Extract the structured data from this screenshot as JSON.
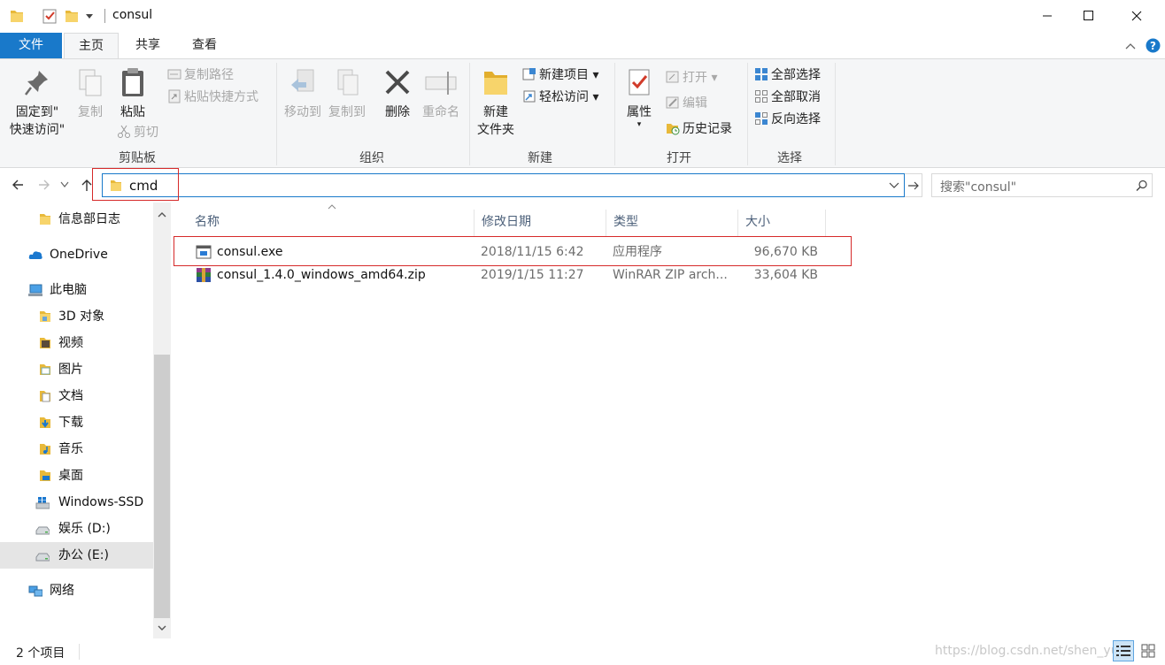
{
  "window": {
    "title": "consul",
    "controls": [
      "minimize-icon",
      "maximize-icon",
      "close-icon"
    ]
  },
  "ribbon_tabs": [
    {
      "label": "文件"
    },
    {
      "label": "主页"
    },
    {
      "label": "共享"
    },
    {
      "label": "查看"
    }
  ],
  "ribbon": {
    "clipboard": {
      "label": "剪贴板",
      "pin_line1": "固定到\"",
      "pin_line2": "快速访问\"",
      "copy": "复制",
      "paste": "粘贴",
      "copy_path": "复制路径",
      "paste_shortcut": "粘贴快捷方式",
      "cut": "剪切"
    },
    "organize": {
      "label": "组织",
      "move_to": "移动到",
      "copy_to": "复制到",
      "delete": "删除",
      "rename": "重命名"
    },
    "new": {
      "label": "新建",
      "new_folder_line1": "新建",
      "new_folder_line2": "文件夹",
      "new_item": "新建项目",
      "easy_access": "轻松访问"
    },
    "open": {
      "label": "打开",
      "properties": "属性",
      "open": "打开",
      "edit": "编辑",
      "history": "历史记录"
    },
    "select": {
      "label": "选择",
      "select_all": "全部选择",
      "select_none": "全部取消",
      "invert": "反向选择"
    }
  },
  "address": {
    "value": "cmd",
    "search_placeholder": "搜索\"consul\""
  },
  "nav": [
    {
      "label": "信息部日志",
      "icon": "folder-icon"
    },
    {
      "label": "OneDrive",
      "icon": "cloud-icon"
    },
    {
      "label": "此电脑",
      "icon": "computer-icon"
    },
    {
      "label": "3D 对象",
      "icon": "3d-objects-icon"
    },
    {
      "label": "视频",
      "icon": "video-icon"
    },
    {
      "label": "图片",
      "icon": "pictures-icon"
    },
    {
      "label": "文档",
      "icon": "documents-icon"
    },
    {
      "label": "下载",
      "icon": "downloads-icon"
    },
    {
      "label": "音乐",
      "icon": "music-icon"
    },
    {
      "label": "桌面",
      "icon": "desktop-icon"
    },
    {
      "label": "Windows-SSD",
      "icon": "windows-drive-icon"
    },
    {
      "label": "娱乐 (D:)",
      "icon": "drive-icon"
    },
    {
      "label": "办公 (E:)",
      "icon": "drive-icon"
    },
    {
      "label": "网络",
      "icon": "network-icon"
    }
  ],
  "columns": [
    "名称",
    "修改日期",
    "类型",
    "大小"
  ],
  "files": [
    {
      "name": "consul.exe",
      "date": "2018/11/15 6:42",
      "type": "应用程序",
      "size": "96,670 KB",
      "icon": "exe-icon"
    },
    {
      "name": "consul_1.4.0_windows_amd64.zip",
      "date": "2019/1/15 11:27",
      "type": "WinRAR ZIP arch...",
      "size": "33,604 KB",
      "icon": "winrar-icon"
    }
  ],
  "status": {
    "count": "2 个项目",
    "watermark": "https://blog.csdn.net/shen_yu"
  },
  "colors": {
    "accent": "#1979ca",
    "highlight": "#d62a2a",
    "ribbon_bg": "#f5f6f7"
  }
}
